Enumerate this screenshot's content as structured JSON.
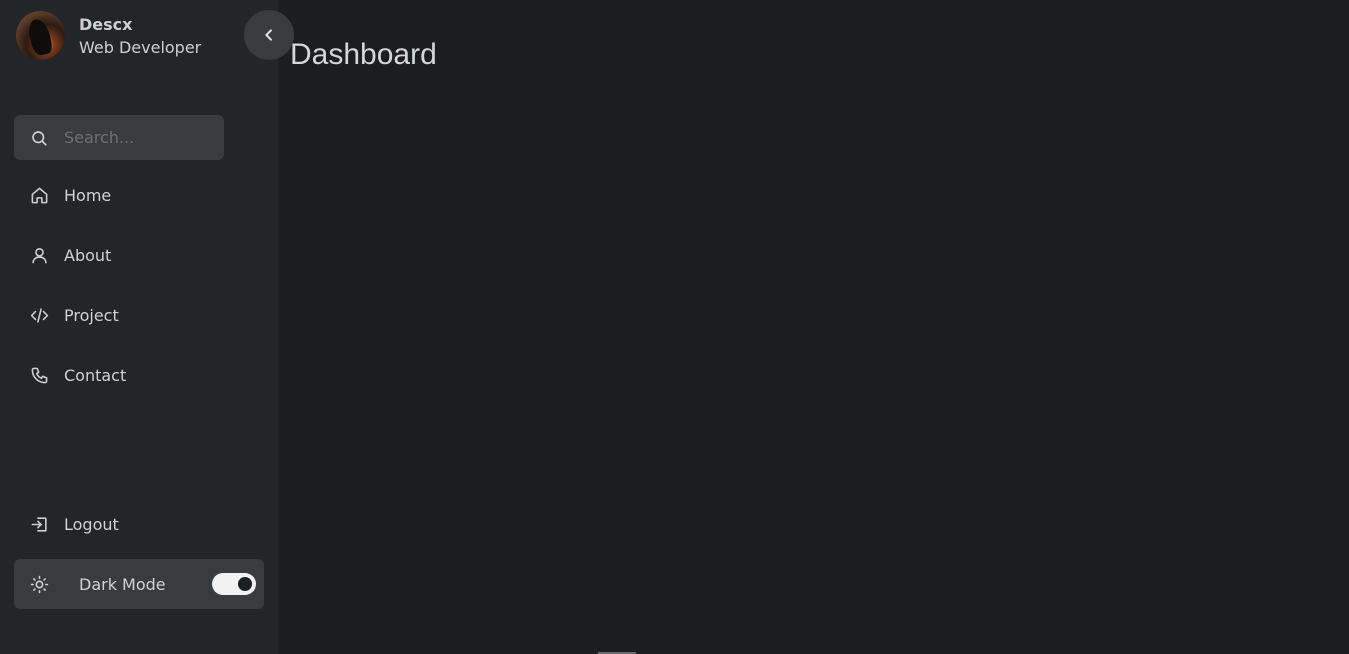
{
  "profile": {
    "name": "Descx",
    "role": "Web Developer"
  },
  "sidebar": {
    "search": {
      "placeholder": "Search...",
      "value": ""
    },
    "items": [
      {
        "label": "Home",
        "icon": "home-icon"
      },
      {
        "label": "About",
        "icon": "user-icon"
      },
      {
        "label": "Project",
        "icon": "code-icon"
      },
      {
        "label": "Contact",
        "icon": "phone-icon"
      }
    ],
    "logout": {
      "label": "Logout",
      "icon": "logout-icon"
    },
    "dark_mode": {
      "label": "Dark Mode",
      "icon": "sun-icon",
      "enabled": true
    }
  },
  "main": {
    "title": "Dashboard"
  },
  "colors": {
    "page_background": "#1c1d20",
    "sidebar_background": "#242528",
    "control_background": "#3a3b3e",
    "text": "#d2d2d2",
    "toggle_track": "#f2f2f2"
  }
}
